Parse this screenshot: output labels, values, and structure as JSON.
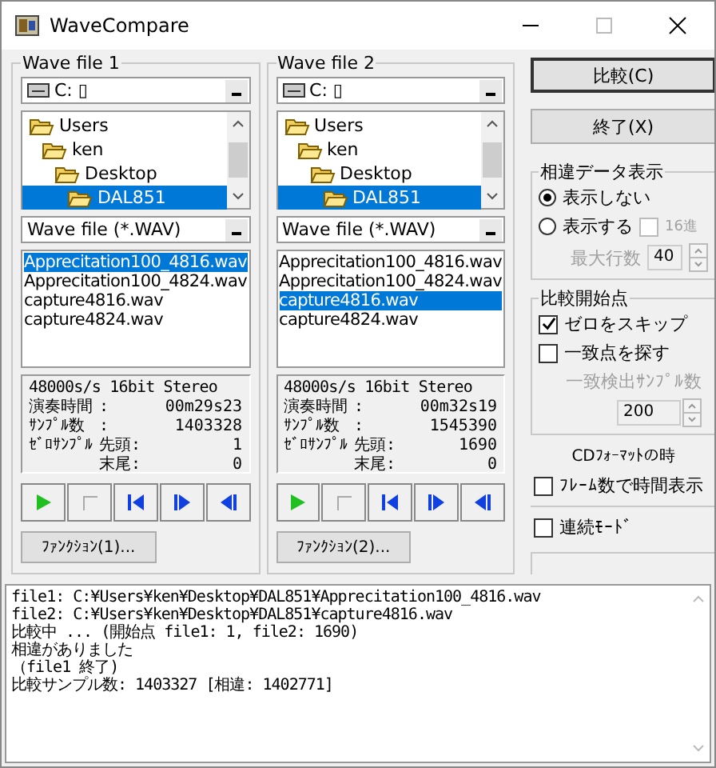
{
  "window": {
    "title": "WaveCompare"
  },
  "panels": [
    {
      "title": "Wave file 1",
      "drive": "C: ▯",
      "folders": [
        {
          "name": "Users",
          "selected": false,
          "children": [
            {
              "name": "ken",
              "selected": false,
              "children": [
                {
                  "name": "Desktop",
                  "selected": false,
                  "children": [
                    {
                      "name": "DAL851",
                      "selected": true
                    }
                  ]
                }
              ]
            }
          ]
        }
      ],
      "filter": "Wave file (*.WAV)",
      "files": [
        {
          "name": "Apprecitation100_4816.wav",
          "selected": true
        },
        {
          "name": "Apprecitation100_4824.wav",
          "selected": false
        },
        {
          "name": "capture4816.wav",
          "selected": false
        },
        {
          "name": "capture4824.wav",
          "selected": false
        }
      ],
      "info": {
        "format": "48000s/s 16bit Stereo",
        "duration_label": "演奏時間",
        "duration_sep": ":",
        "duration": "00m29s23",
        "samples_label": "ｻﾝﾌﾟﾙ数",
        "samples_sep": ":",
        "samples": "1403328",
        "zero_label": "ｾﾞﾛｻﾝﾌﾟﾙ",
        "head_label": "先頭:",
        "head": "1",
        "tail_label": "末尾:",
        "tail": "0"
      },
      "function_button": "ﾌｧﾝｸｼｮﾝ(1)..."
    },
    {
      "title": "Wave file 2",
      "drive": "C: ▯",
      "folders": [
        {
          "name": "Users",
          "selected": false,
          "children": [
            {
              "name": "ken",
              "selected": false,
              "children": [
                {
                  "name": "Desktop",
                  "selected": false,
                  "children": [
                    {
                      "name": "DAL851",
                      "selected": true
                    }
                  ]
                }
              ]
            }
          ]
        }
      ],
      "filter": "Wave file (*.WAV)",
      "files": [
        {
          "name": "Apprecitation100_4816.wav",
          "selected": false
        },
        {
          "name": "Apprecitation100_4824.wav",
          "selected": false
        },
        {
          "name": "capture4816.wav",
          "selected": true
        },
        {
          "name": "capture4824.wav",
          "selected": false
        }
      ],
      "info": {
        "format": "48000s/s 16bit Stereo",
        "duration_label": "演奏時間",
        "duration_sep": ":",
        "duration": "00m32s19",
        "samples_label": "ｻﾝﾌﾟﾙ数",
        "samples_sep": ":",
        "samples": "1545390",
        "zero_label": "ｾﾞﾛｻﾝﾌﾟﾙ",
        "head_label": "先頭:",
        "head": "1690",
        "tail_label": "末尾:",
        "tail": "0"
      },
      "function_button": "ﾌｧﾝｸｼｮﾝ(2)..."
    }
  ],
  "compare_button": "比較(C)",
  "exit_button": "終了(X)",
  "diff_display": {
    "title": "相違データ表示",
    "options": [
      {
        "label": "表示しない",
        "selected": true
      },
      {
        "label": "表示する",
        "selected": false
      }
    ],
    "hex": {
      "label": "16進",
      "checked": false,
      "disabled": true
    },
    "max_rows": {
      "label": "最大行数",
      "value": "40",
      "disabled": true
    }
  },
  "start_point": {
    "title": "比較開始点",
    "skip_zero": {
      "label": "ゼロをスキップ",
      "checked": true
    },
    "find_match": {
      "label": "一致点を探す",
      "checked": false
    },
    "match_samples": {
      "label": "一致検出ｻﾝﾌﾟﾙ数",
      "value": "200",
      "disabled": true
    }
  },
  "cd_note": "CDﾌｫｰﾏｯﾄの時",
  "frame_time": {
    "label": "ﾌﾚｰﾑ数で時間表示",
    "checked": false
  },
  "continuous": {
    "label": "連続ﾓｰﾄﾞ",
    "checked": false
  },
  "log": [
    "file1: C:¥Users¥ken¥Desktop¥DAL851¥Apprecitation100_4816.wav",
    "file2: C:¥Users¥ken¥Desktop¥DAL851¥capture4816.wav",
    "比較中 ... (開始点 file1: 1, file2: 1690)",
    "相違がありました",
    "（file1 終了)",
    "比較サンプル数: 1403327 [相違: 1402771]"
  ]
}
